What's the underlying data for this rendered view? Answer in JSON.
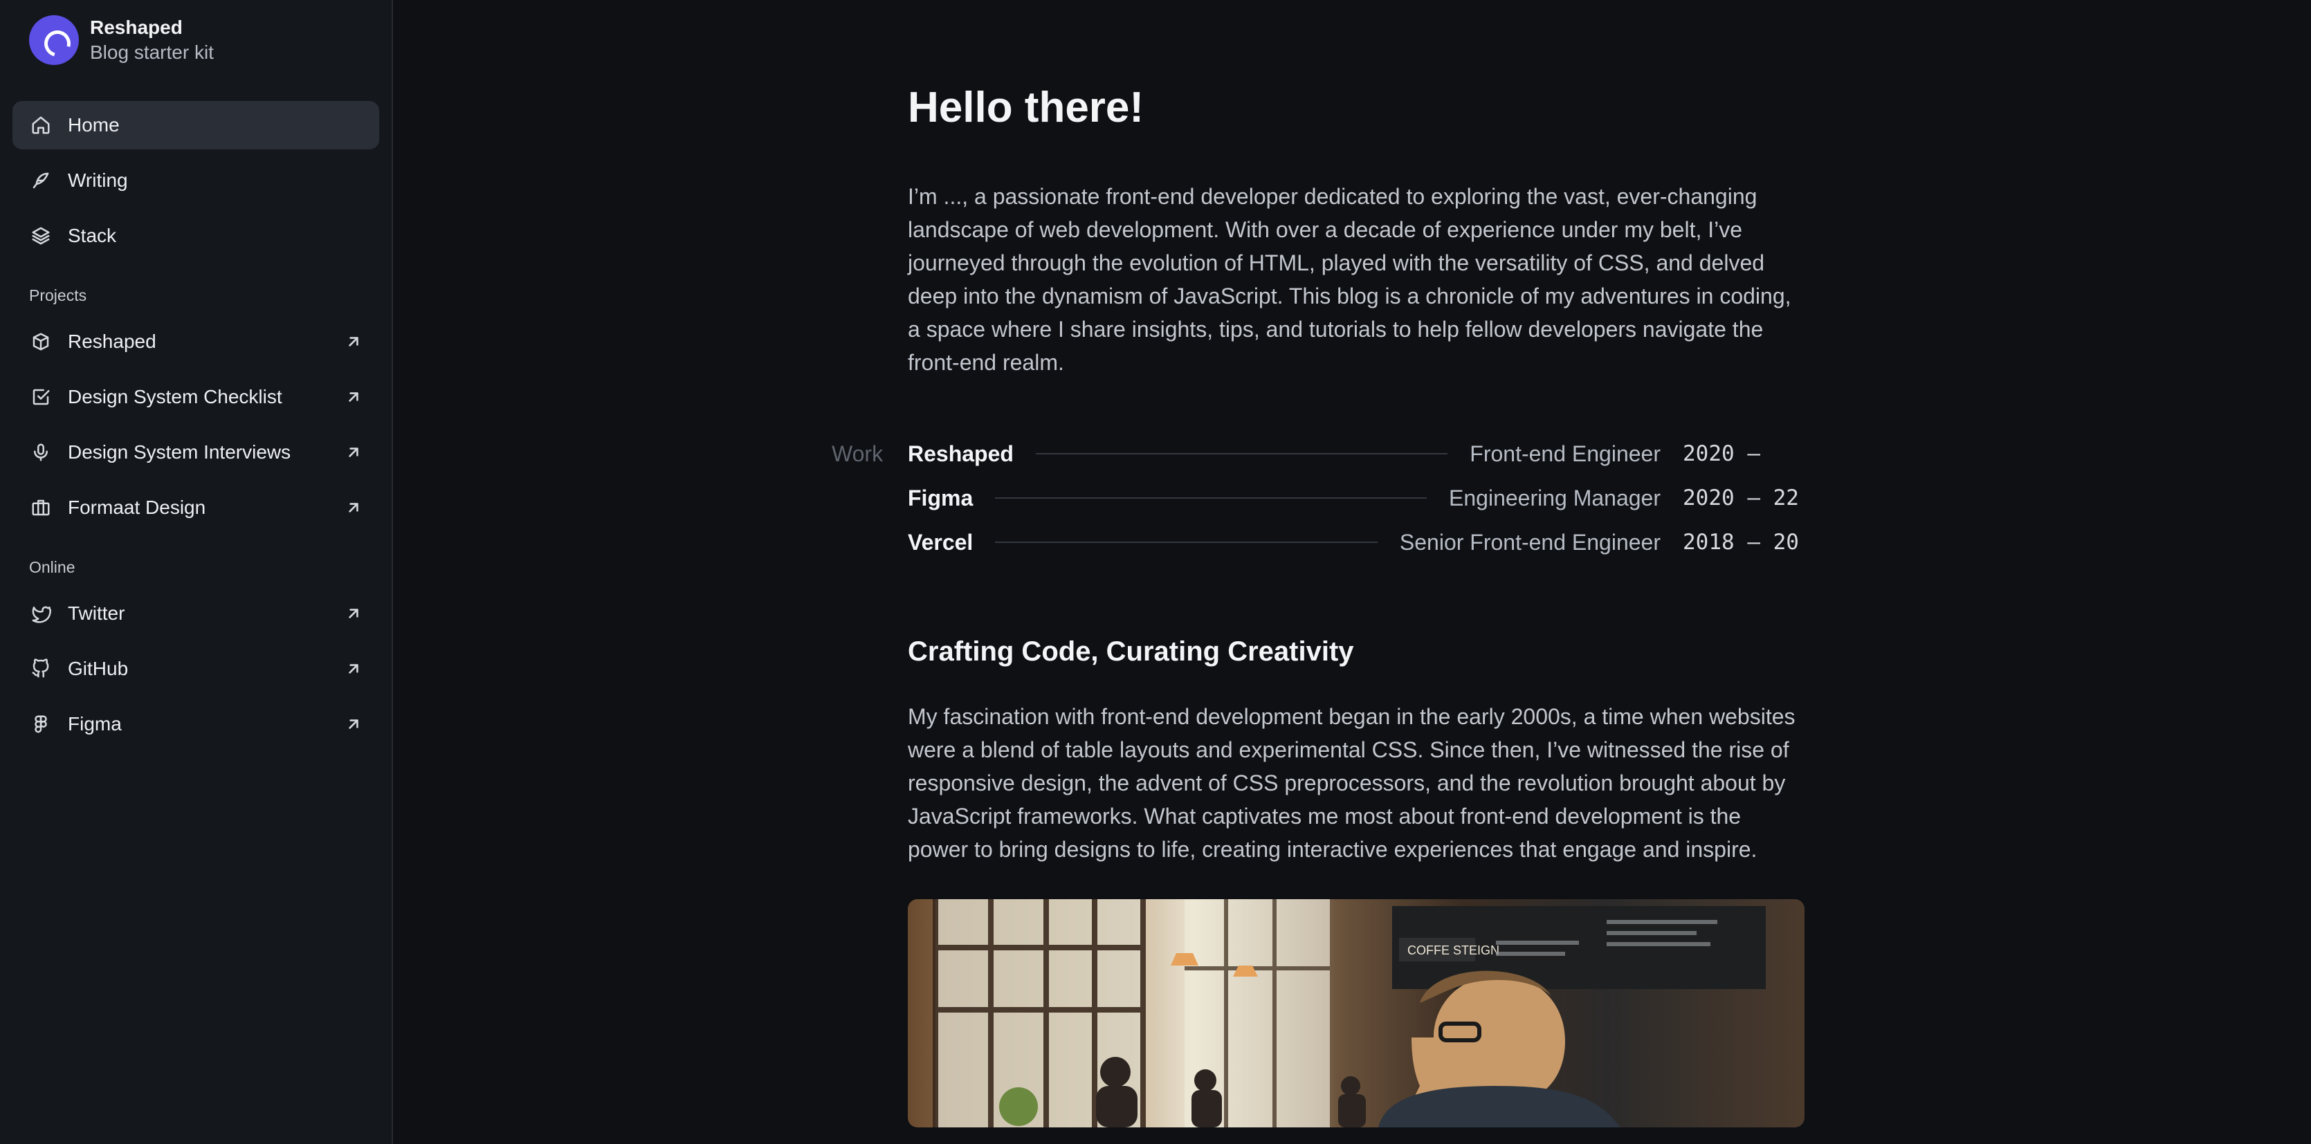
{
  "sidebar": {
    "brand": {
      "name": "Reshaped",
      "subtitle": "Blog starter kit"
    },
    "nav": [
      {
        "label": "Home",
        "icon": "home-icon",
        "active": true
      },
      {
        "label": "Writing",
        "icon": "feather-icon"
      },
      {
        "label": "Stack",
        "icon": "stack-icon"
      }
    ],
    "projects_title": "Projects",
    "projects": [
      {
        "label": "Reshaped",
        "icon": "box-icon"
      },
      {
        "label": "Design System Checklist",
        "icon": "checkbox-icon"
      },
      {
        "label": "Design System Interviews",
        "icon": "microphone-icon"
      },
      {
        "label": "Formaat Design",
        "icon": "briefcase-icon"
      }
    ],
    "online_title": "Online",
    "online": [
      {
        "label": "Twitter",
        "icon": "twitter-icon"
      },
      {
        "label": "GitHub",
        "icon": "github-icon"
      },
      {
        "label": "Figma",
        "icon": "figma-icon"
      }
    ]
  },
  "main": {
    "title": "Hello there!",
    "intro": "I’m ..., a passionate front-end developer dedicated to exploring the vast, ever-changing landscape of web development. With over a decade of experience under my belt, I’ve journeyed through the evolution of HTML, played with the versatility of CSS, and delved deep into the dynamism of JavaScript. This blog is a chronicle of my adventures in coding, a space where I share insights, tips, and tutorials to help fellow developers navigate the front-end realm.",
    "work_label": "Work",
    "work": [
      {
        "company": "Reshaped",
        "role": "Front-end Engineer",
        "years": "2020 —"
      },
      {
        "company": "Figma",
        "role": "Engineering Manager",
        "years": "2020 — 22"
      },
      {
        "company": "Vercel",
        "role": "Senior Front-end Engineer",
        "years": "2018 — 20"
      }
    ],
    "section_heading": "Crafting Code, Curating Creativity",
    "section_body": "My fascination with front-end development began in the early 2000s, a time when websites were a blend of table layouts and experimental CSS. Since then, I’ve witnessed the rise of responsive design, the advent of CSS preprocessors, and the revolution brought about by JavaScript frameworks. What captivates me most about front-end development is the power to bring designs to life, creating interactive experiences that engage and inspire.",
    "hero_sign": "COFFE STEIGN"
  }
}
